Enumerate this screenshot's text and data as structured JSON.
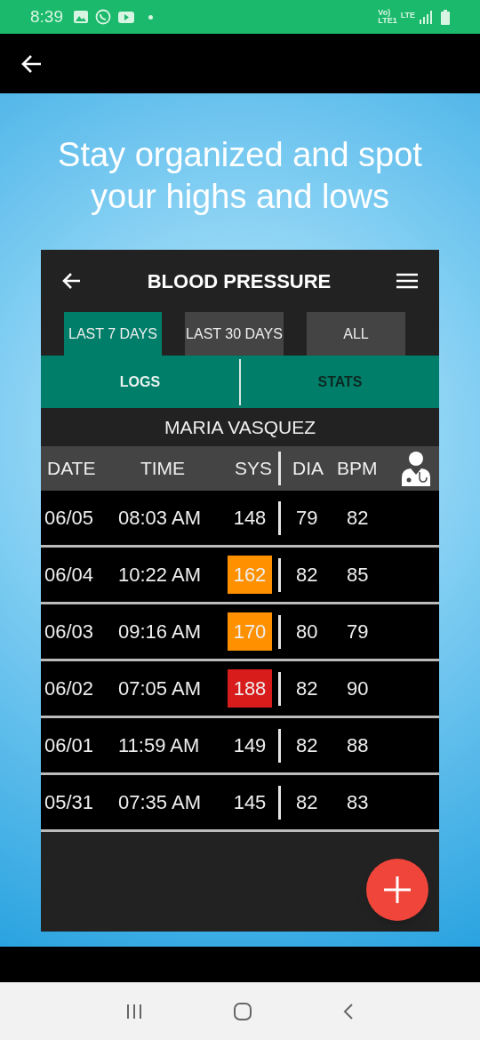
{
  "status_bar": {
    "time": "8:39",
    "volte": "Vo)",
    "lte_top": "LTE",
    "lte_bottom": "LTE1"
  },
  "headline": "Stay organized and spot your highs and lows",
  "app": {
    "title": "BLOOD PRESSURE",
    "ranges": [
      {
        "label": "LAST 7 DAYS",
        "selected": true
      },
      {
        "label": "LAST 30 DAYS",
        "selected": false
      },
      {
        "label": "ALL",
        "selected": false
      }
    ],
    "views": [
      {
        "label": "LOGS",
        "selected": true
      },
      {
        "label": "STATS",
        "selected": false
      }
    ],
    "patient": "MARIA VASQUEZ",
    "columns": [
      "DATE",
      "TIME",
      "SYS",
      "DIA",
      "BPM"
    ],
    "rows": [
      {
        "date": "06/05",
        "time": "08:03 AM",
        "sys": "148",
        "dia": "79",
        "bpm": "82",
        "kind": "normal"
      },
      {
        "date": "06/04",
        "time": "10:22 AM",
        "sys": "162",
        "dia": "82",
        "bpm": "85",
        "kind": "elevated"
      },
      {
        "date": "06/03",
        "time": "09:16 AM",
        "sys": "170",
        "dia": "80",
        "bpm": "79",
        "kind": "elevated"
      },
      {
        "date": "06/02",
        "time": "07:05 AM",
        "sys": "188",
        "dia": "82",
        "bpm": "90",
        "kind": "high"
      },
      {
        "date": "06/01",
        "time": "11:59 AM",
        "sys": "149",
        "dia": "82",
        "bpm": "88",
        "kind": "normal"
      },
      {
        "date": "05/31",
        "time": "07:35 AM",
        "sys": "145",
        "dia": "82",
        "bpm": "83",
        "kind": "normal"
      }
    ]
  }
}
